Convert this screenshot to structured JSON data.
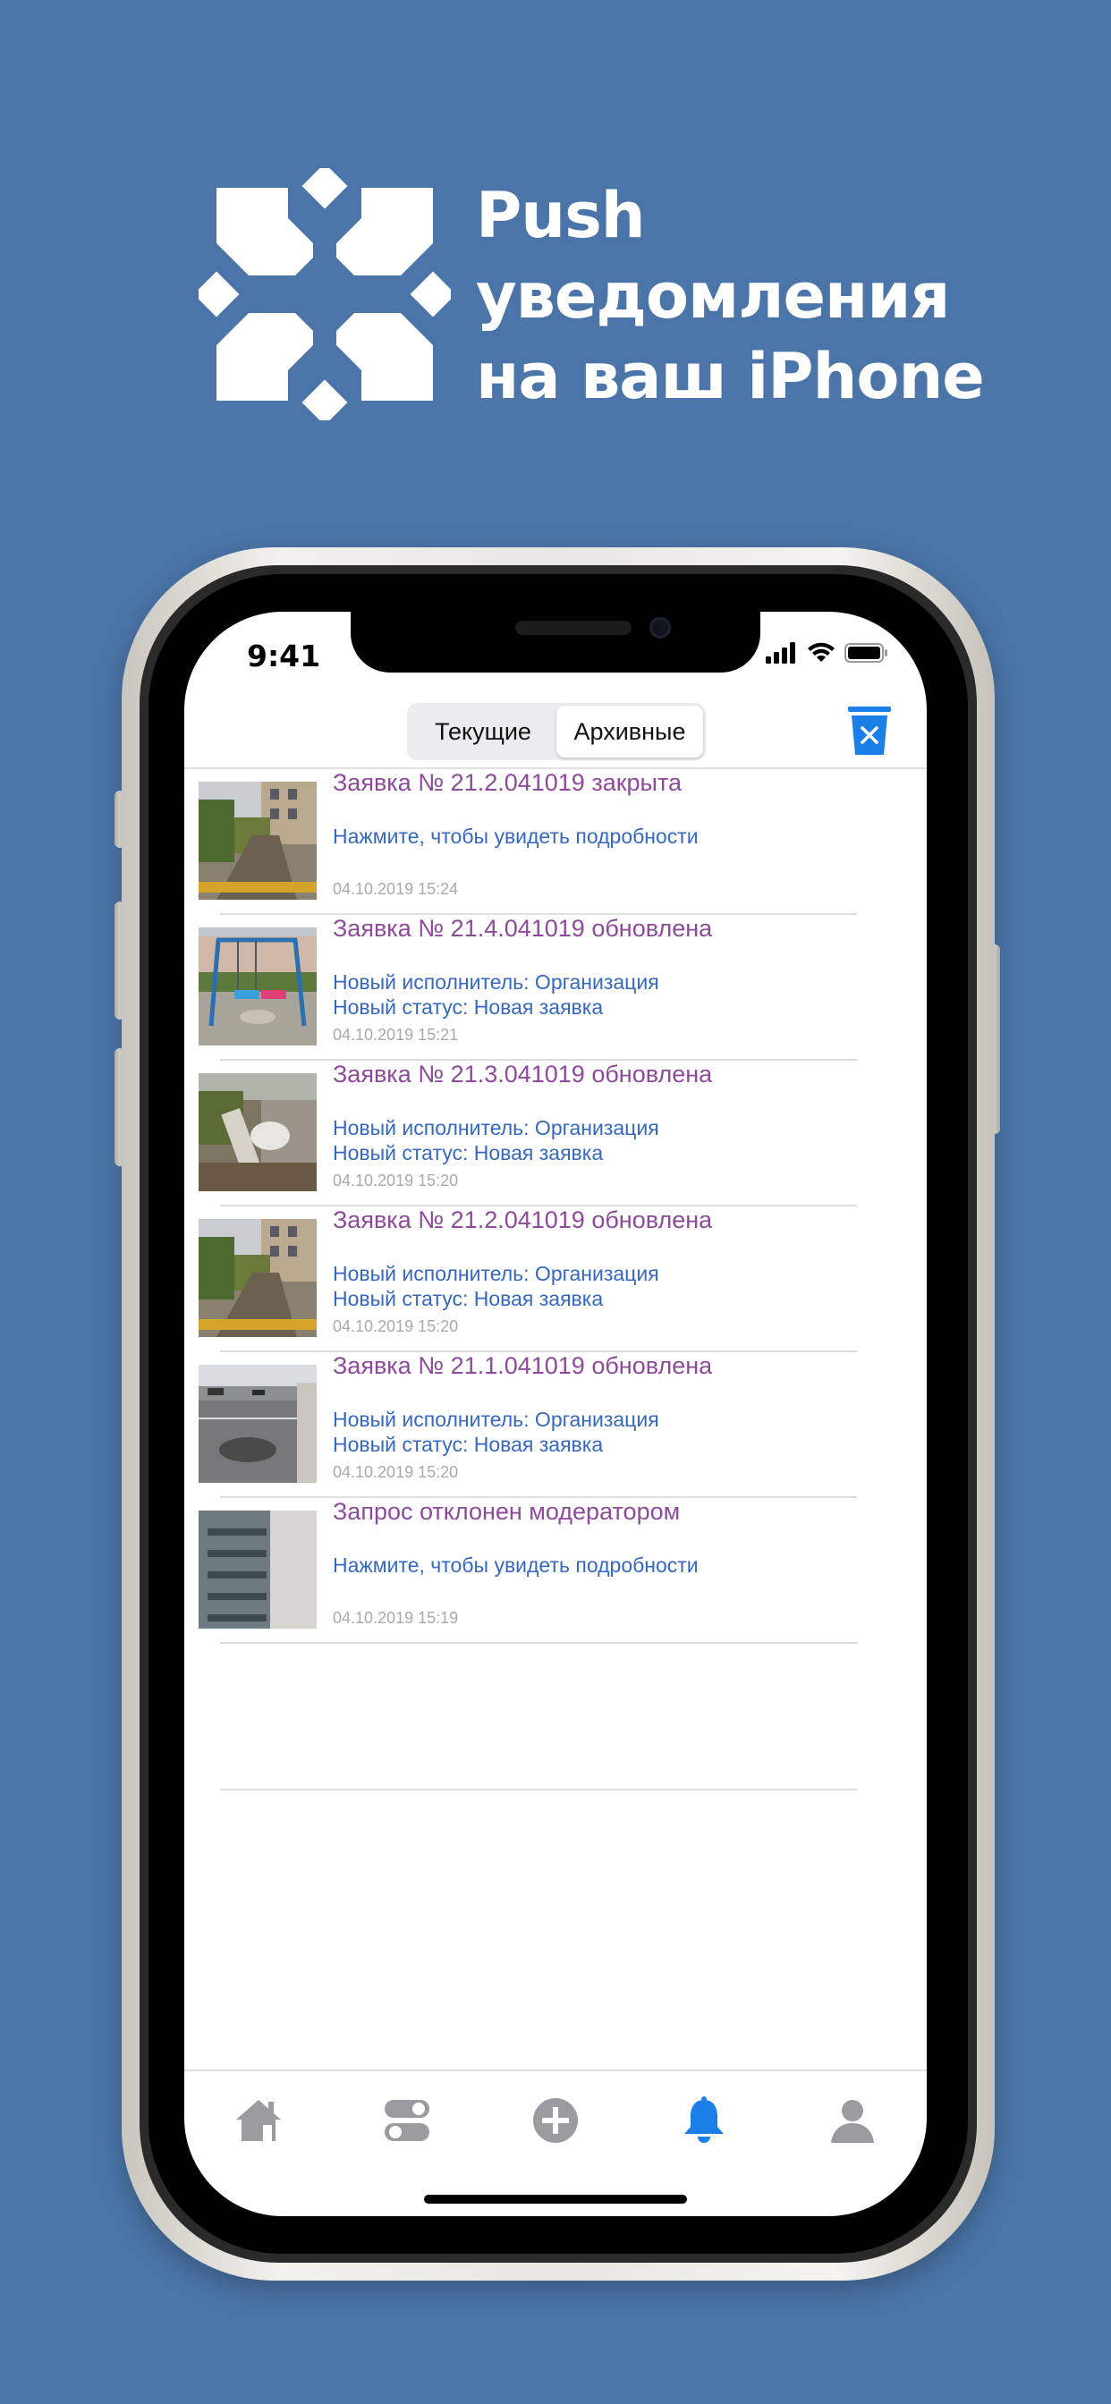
{
  "header": {
    "logo_icon": "snowflake-logo-icon",
    "title_lines": [
      "Push",
      "уведомления",
      "на ваш iPhone"
    ]
  },
  "status_bar": {
    "time": "9:41",
    "icons": [
      "cellular-signal-icon",
      "wifi-icon",
      "battery-icon"
    ]
  },
  "segmented": {
    "items": [
      {
        "label": "Текущие",
        "active": false
      },
      {
        "label": "Архивные",
        "active": true
      }
    ]
  },
  "toolbar": {
    "clear_icon": "trash-clear-icon",
    "accent": "#1a7fe6"
  },
  "notifications": [
    {
      "title": "Заявка № 21.2.041019 закрыта",
      "line1": "Нажмите, чтобы увидеть подробности",
      "line2": "",
      "date": "04.10.2019 15:24",
      "thumb": "courtyard-path"
    },
    {
      "title": "Заявка № 21.4.041019 обновлена",
      "line1": "Новый исполнитель: Организация",
      "line2": "Новый статус: Новая заявка",
      "date": "04.10.2019 15:21",
      "thumb": "playground-swings"
    },
    {
      "title": "Заявка № 21.3.041019 обновлена",
      "line1": "Новый исполнитель: Организация",
      "line2": "Новый статус: Новая заявка",
      "date": "04.10.2019 15:20",
      "thumb": "debris-pipes"
    },
    {
      "title": "Заявка № 21.2.041019 обновлена",
      "line1": "Новый исполнитель: Организация",
      "line2": "Новый статус: Новая заявка",
      "date": "04.10.2019 15:20",
      "thumb": "courtyard-path"
    },
    {
      "title": "Заявка № 21.1.041019 обновлена",
      "line1": "Новый исполнитель: Организация",
      "line2": "Новый статус: Новая заявка",
      "date": "04.10.2019 15:20",
      "thumb": "road-pothole"
    },
    {
      "title": "Запрос отклонен модератором",
      "line1": "Нажмите, чтобы увидеть подробности",
      "line2": "",
      "date": "04.10.2019 15:19",
      "thumb": "broken-stairs"
    }
  ],
  "tabbar": {
    "items": [
      {
        "icon": "home-icon",
        "active": false
      },
      {
        "icon": "toggles-icon",
        "active": false
      },
      {
        "icon": "add-circle-icon",
        "active": false
      },
      {
        "icon": "bell-icon",
        "active": true
      },
      {
        "icon": "profile-icon",
        "active": false
      }
    ],
    "active_color": "#1a7fe6",
    "inactive_color": "#9b9b9f"
  },
  "colors": {
    "background": "#4b75a8",
    "title_purple": "#8e4a9a",
    "link_blue": "#3568c4",
    "date_gray": "#a9a9ad"
  }
}
